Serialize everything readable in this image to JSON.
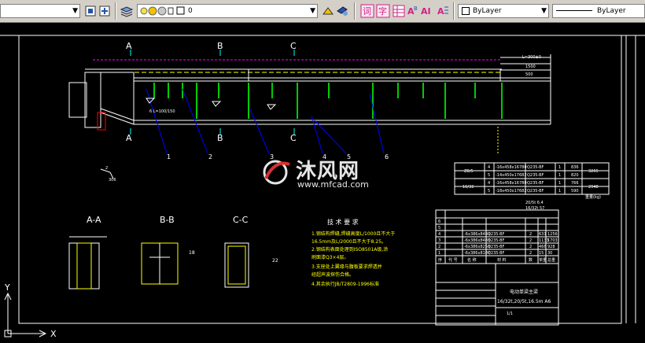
{
  "toolbar": {
    "layer_name": "0",
    "color_combo": "ByLayer",
    "linetype_combo": "ByLayer",
    "colors": {
      "toolbar_bg": "#d4d0c8",
      "icon_blue": "#2255aa",
      "icon_yellow": "#f2c200",
      "icon_magenta": "#cc2288"
    }
  },
  "drawing": {
    "section_labels": {
      "a_top": "A",
      "b_top": "B",
      "c_top": "C",
      "a_bot": "A",
      "b_bot": "B",
      "c_bot": "C"
    },
    "callouts": [
      "1",
      "2",
      "3",
      "4",
      "5",
      "6"
    ],
    "dims": {
      "d1": "L=300±0",
      "d2": "1500",
      "d3": "500",
      "d4": "6  L=100/150",
      "d5": "306",
      "d6": "2"
    },
    "section_views": {
      "aa": "A-A",
      "bb": "B-B",
      "cc": "C-C",
      "dim18": "18",
      "dim22": "22"
    },
    "notes": {
      "title": "技 术 要 求",
      "lines": [
        "1.钢结构焊缝,焊缝高度L/1000且不大于",
        "  16.5mm及L/2000且不大于8.25。",
        "2.钢结构表面处理到ISO8501A级,涂",
        "  刷面漆Q3×4层。",
        "3.支座处上翼缘与腹板要求焊透并",
        "  经超声波探伤合格。",
        "4.其余执行JB/T2809-1996标准"
      ]
    },
    "upper_table": {
      "rows": [
        [
          "ZB/5",
          "4",
          "-16x458x16780",
          "Q235-BF",
          "1",
          "836",
          "3265"
        ],
        [
          "",
          "5",
          "-14x450x17682",
          "Q235-BF",
          "1",
          "820",
          ""
        ],
        [
          "16/32",
          "4",
          "-16x458x16780",
          "Q235-BF",
          "1",
          "766",
          "2948"
        ],
        [
          "",
          "5",
          "-18x450x17682",
          "Q235-BF",
          "1",
          "590",
          ""
        ]
      ],
      "footer": "重量(kg)"
    },
    "parts_table": {
      "header_top": "20/5t 6.4",
      "header_sub": "16/32t 57",
      "rows": [
        [
          "6",
          "",
          "",
          "",
          "",
          "",
          ""
        ],
        [
          "5",
          "",
          "",
          "",
          "",
          "",
          ""
        ],
        [
          "4",
          "",
          "-6x386x8480",
          "Q235-BF",
          "2",
          "631",
          "1256"
        ],
        [
          "3",
          "",
          "-6x386x8483",
          "Q235-BF",
          "2",
          "1133",
          "1703"
        ],
        [
          "2",
          "",
          "-6x386x8258",
          "Q235-BF",
          "2",
          "466",
          "928"
        ],
        [
          "1",
          "",
          "-6x386x8187",
          "Q235-BF",
          "2",
          "15",
          "30"
        ]
      ],
      "cols": [
        "序",
        "代 号",
        "名 称",
        "材 料",
        "数",
        "单重",
        "总重"
      ],
      "title_block": {
        "name": "电动单梁主梁",
        "spec": "16/32t,20/5t,16.5m A6",
        "sheet": "1/1"
      }
    },
    "watermark": {
      "brand": "沐风网",
      "url": "www.mfcad.com"
    },
    "ucs": {
      "x": "X",
      "y": "Y"
    }
  }
}
